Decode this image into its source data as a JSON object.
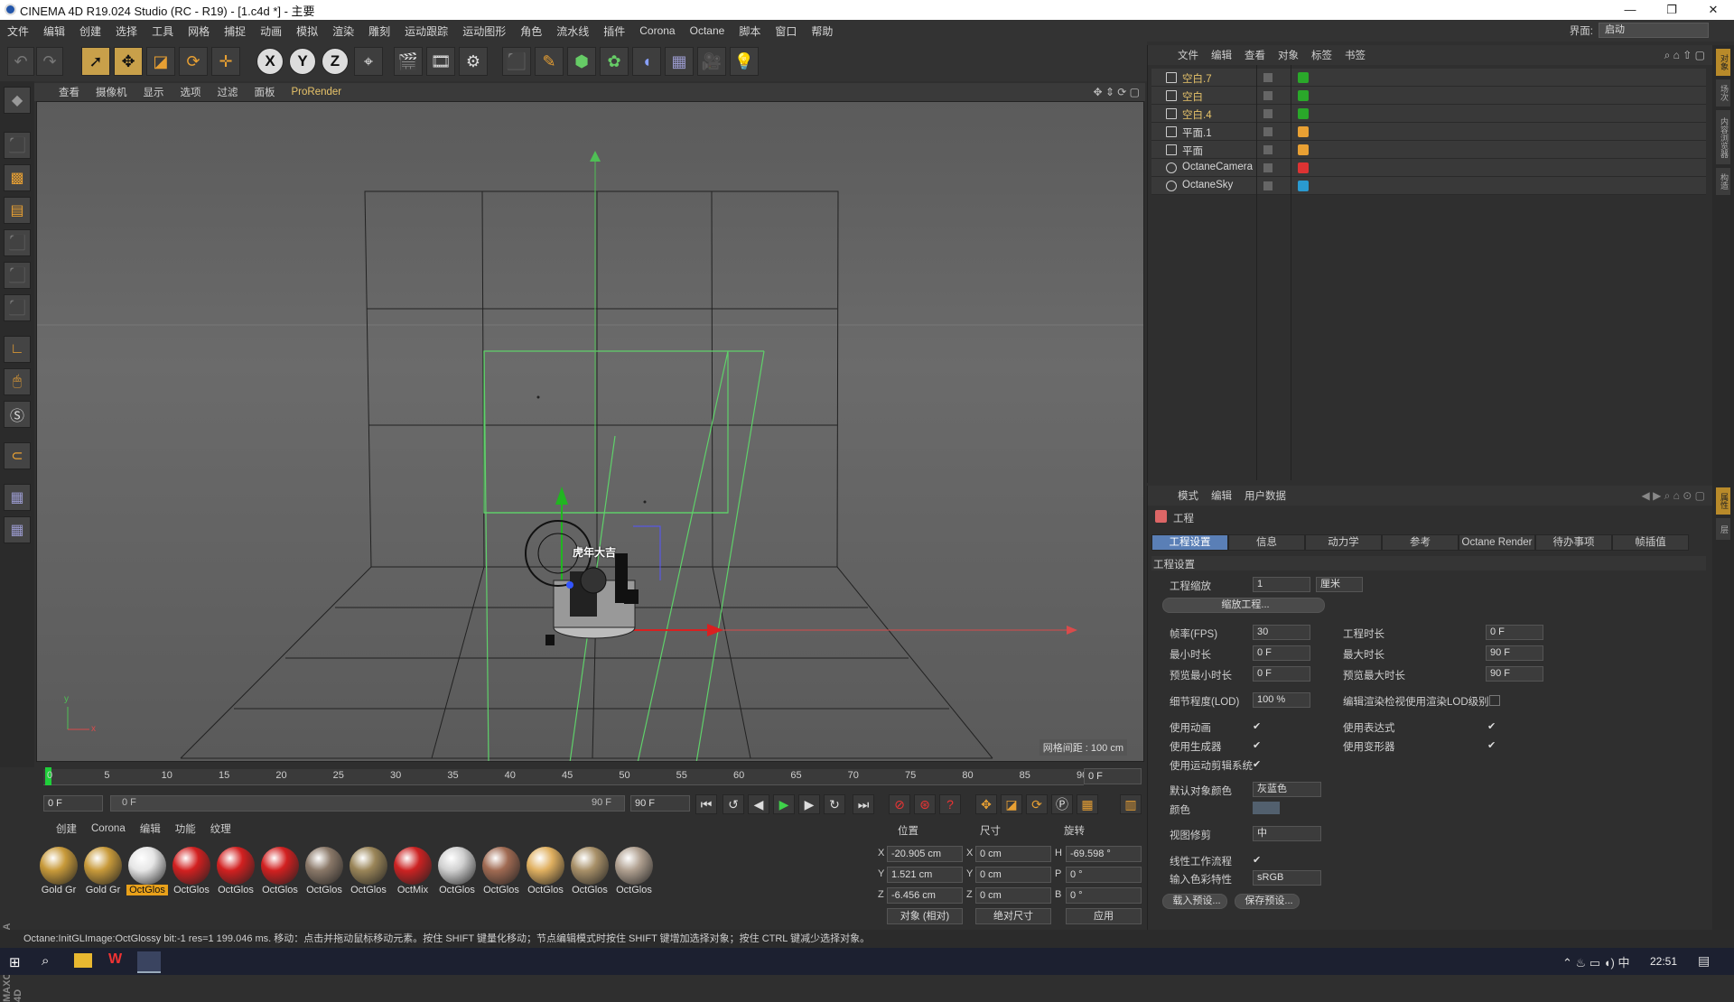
{
  "window": {
    "title": "CINEMA 4D R19.024 Studio (RC - R19) - [1.c4d *] - 主要",
    "minimize": "—",
    "maximize": "❐",
    "close": "✕"
  },
  "menubar": {
    "items": [
      "文件",
      "编辑",
      "创建",
      "选择",
      "工具",
      "网格",
      "捕捉",
      "动画",
      "模拟",
      "渲染",
      "雕刻",
      "运动跟踪",
      "运动图形",
      "角色",
      "流水线",
      "插件",
      "Corona",
      "Octane",
      "脚本",
      "窗口",
      "帮助"
    ],
    "layout_label": "界面:",
    "layout_value": "启动"
  },
  "viewport": {
    "menu": [
      "查看",
      "摄像机",
      "显示",
      "选项",
      "过滤",
      "面板",
      "ProRender"
    ],
    "grid_spacing": "网格间距 : 100 cm",
    "overlay_text": "虎年大吉",
    "axis_x": "x",
    "axis_y": "y"
  },
  "timeline": {
    "ticks": [
      "0",
      "5",
      "10",
      "15",
      "20",
      "25",
      "30",
      "35",
      "40",
      "45",
      "50",
      "55",
      "60",
      "65",
      "70",
      "75",
      "80",
      "85",
      "90"
    ],
    "end_field": "0 F",
    "current_frame": "0 F",
    "range_start": "0 F",
    "range_end": "90 F",
    "max_frame": "90 F"
  },
  "materials": {
    "menu": [
      "创建",
      "Corona",
      "编辑",
      "功能",
      "纹理"
    ],
    "items": [
      {
        "label": "Gold Gr",
        "color": "#c89a3a",
        "selected": false
      },
      {
        "label": "Gold Gr",
        "color": "#c89a3a",
        "selected": false
      },
      {
        "label": "OctGlos",
        "color": "#e6e6e6",
        "selected": true
      },
      {
        "label": "OctGlos",
        "color": "#d22020",
        "selected": false
      },
      {
        "label": "OctGlos",
        "color": "#d22020",
        "selected": false
      },
      {
        "label": "OctGlos",
        "color": "#d22020",
        "selected": false
      },
      {
        "label": "OctGlos",
        "color": "#8a7868",
        "selected": false
      },
      {
        "label": "OctGlos",
        "color": "#9a8558",
        "selected": false
      },
      {
        "label": "OctMix",
        "color": "#cc2222",
        "selected": false
      },
      {
        "label": "OctGlos",
        "color": "#d0d0d0",
        "selected": false
      },
      {
        "label": "OctGlos",
        "color": "#a06a52",
        "selected": false
      },
      {
        "label": "OctGlos",
        "color": "#e0b060",
        "selected": false
      },
      {
        "label": "OctGlos",
        "color": "#a89068",
        "selected": false
      },
      {
        "label": "OctGlos",
        "color": "#b0a090",
        "selected": false
      }
    ]
  },
  "coords": {
    "headers": {
      "pos": "位置",
      "size": "尺寸",
      "rot": "旋转"
    },
    "rows": [
      {
        "axis": "X",
        "pos": "-20.905 cm",
        "saxis": "X",
        "size": "0 cm",
        "raxis": "H",
        "rot": "-69.598 °"
      },
      {
        "axis": "Y",
        "pos": "1.521 cm",
        "saxis": "Y",
        "size": "0 cm",
        "raxis": "P",
        "rot": "0 °"
      },
      {
        "axis": "Z",
        "pos": "-6.456 cm",
        "saxis": "Z",
        "size": "0 cm",
        "raxis": "B",
        "rot": "0 °"
      }
    ],
    "mode_object": "对象 (相对)",
    "mode_size": "绝对尺寸",
    "apply": "应用"
  },
  "status": {
    "text": "Octane:InitGLImage:OctGlossy  bit:-1 res=1  199.046 ms.   移动：点击并拖动鼠标移动元素。按住 SHIFT 键量化移动；节点编辑模式时按住 SHIFT 键增加选择对象；按住 CTRL 键减少选择对象。"
  },
  "objects": {
    "menu": [
      "文件",
      "编辑",
      "查看",
      "对象",
      "标签",
      "书签"
    ],
    "items": [
      {
        "name": "空白.7",
        "highlight": true
      },
      {
        "name": "空白",
        "highlight": true
      },
      {
        "name": "空白.4",
        "highlight": true
      },
      {
        "name": "平面.1",
        "highlight": false
      },
      {
        "name": "平面",
        "highlight": false
      },
      {
        "name": "OctaneCamera",
        "highlight": false
      },
      {
        "name": "OctaneSky",
        "highlight": false
      }
    ]
  },
  "attributes": {
    "menu": [
      "模式",
      "编辑",
      "用户数据"
    ],
    "heading": "工程",
    "tabs": [
      "工程设置",
      "信息",
      "动力学",
      "参考",
      "Octane Render",
      "待办事项",
      "帧插值"
    ],
    "section": "工程设置",
    "scale_label": "工程缩放",
    "scale_value": "1",
    "scale_unit": "厘米",
    "scale_button": "缩放工程...",
    "fps_label": "帧率(FPS)",
    "fps": "30",
    "project_time_label": "工程时长",
    "project_time": "0 F",
    "min_time_label": "最小时长",
    "min_time": "0 F",
    "max_time_label": "最大时长",
    "max_time": "90 F",
    "preview_min_label": "预览最小时长",
    "preview_min": "0 F",
    "preview_max_label": "预览最大时长",
    "preview_max": "90 F",
    "lod_label": "细节程度(LOD)",
    "lod": "100 %",
    "lod_render_label": "编辑渲染检视使用渲染LOD级别",
    "use_anim": "使用动画",
    "use_expr": "使用表达式",
    "use_gen": "使用生成器",
    "use_deform": "使用变形器",
    "use_motion": "使用运动剪辑系统",
    "default_color_label": "默认对象颜色",
    "default_color": "灰蓝色",
    "color_label": "颜色",
    "view_clip_label": "视图修剪",
    "view_clip": "中",
    "linear_label": "线性工作流程",
    "input_color_label": "输入色彩特性",
    "input_color": "sRGB",
    "load_preset": "载入预设...",
    "save_preset": "保存预设..."
  },
  "taskbar": {
    "time": "22:51"
  }
}
